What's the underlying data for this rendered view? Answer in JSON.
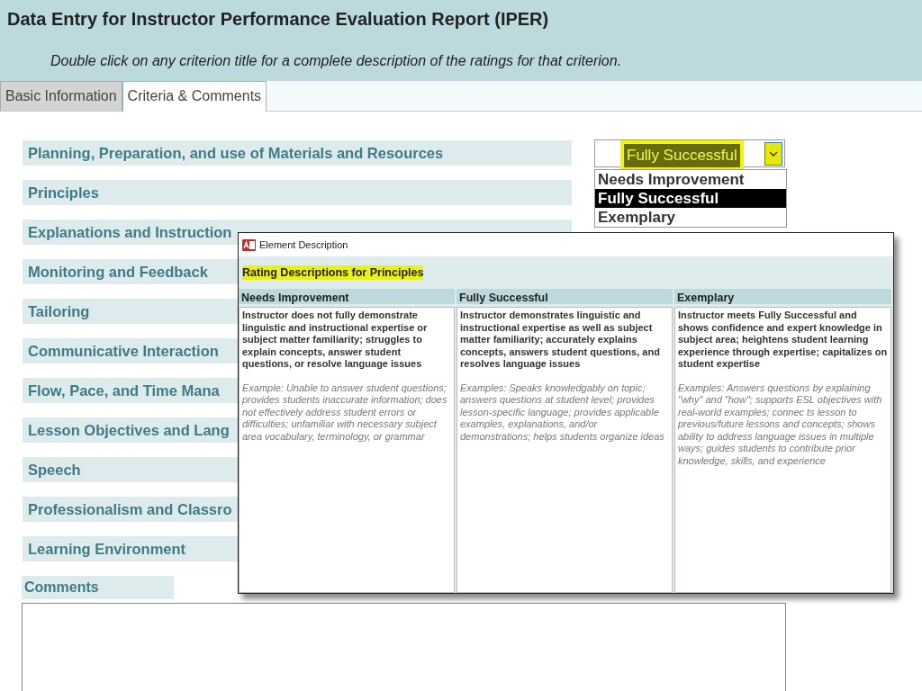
{
  "window": {
    "title": "Data Entry for Instructor Performance Evaluation Report (IPER)",
    "instruction": "Double click on any criterion title for a complete description of the ratings for that criterion."
  },
  "tabs": [
    {
      "label": "Basic Information",
      "selected": false
    },
    {
      "label": "Criteria & Comments",
      "selected": true
    }
  ],
  "criteria": [
    "Planning, Preparation, and use of Materials and Resources",
    "Principles",
    "Explanations and Instruction",
    "Monitoring and Feedback",
    "Tailoring",
    "Communicative Interaction",
    "Flow, Pace, and Time Mana",
    "Lesson Objectives and Lang",
    "Speech",
    "Professionalism and Classro",
    "Learning Environment"
  ],
  "rating_dropdown": {
    "value": "Fully Successful",
    "expanded": true,
    "options": [
      {
        "label": "Needs Improvement",
        "selected": false
      },
      {
        "label": "Fully Successful",
        "selected": true
      },
      {
        "label": "Exemplary",
        "selected": false
      }
    ]
  },
  "comments": {
    "label": "Comments"
  },
  "dialog": {
    "title": "Element Description",
    "heading": "Rating Descriptions for Principles",
    "columns": [
      {
        "name": "Needs Improvement",
        "description": "Instructor does not fully demonstrate linguistic and instructional expertise or subject matter familiarity; struggles to explain concepts, answer student questions, or resolve language issues",
        "example": "Example: Unable to answer student questions; provides students inaccurate information; does not effectively address student errors or difficulties; unfamiliar with necessary subject area vocabulary, terminology, or grammar"
      },
      {
        "name": "Fully Successful",
        "description": "Instructor demonstrates linguistic and instructional expertise as well as subject matter familiarity; accurately explains concepts, answers student questions, and resolves language issues",
        "example": "Examples: Speaks knowledgably on topic; answers questions at student level; provides lesson-specific language; provides applicable examples, explanations, and/or demonstrations; helps students organize ideas"
      },
      {
        "name": "Exemplary",
        "description": "Instructor meets Fully Successful and shows confidence and expert knowledge in subject area; heightens student learning experience through expertise; capitalizes on student expertise",
        "example": "Examples: Answers questions by explaining \"why\" and \"how\"; supports ESL objectives with real-world examples; connec ts lesson to previous/future lessons and concepts; shows ability to address language issues in multiple ways; guides students to contribute prior knowledge, skills, and experience"
      }
    ]
  }
}
